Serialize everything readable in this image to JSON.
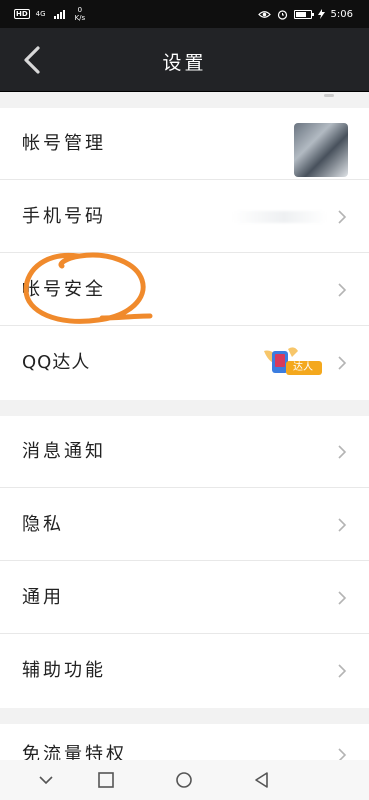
{
  "status_bar": {
    "network": "4G",
    "speed_value": "0",
    "speed_unit": "K/s",
    "time": "5:06"
  },
  "header": {
    "title": "设置",
    "back_icon": "chevron-left-icon"
  },
  "groups": [
    {
      "items": [
        {
          "label": "帐号管理",
          "accessory": "avatar"
        },
        {
          "label": "手机号码",
          "accessory": "phone-number"
        },
        {
          "label": "帐号安全",
          "accessory": "chevron-right-icon",
          "annotation": "orange circle highlight"
        },
        {
          "label": "QQ达人",
          "accessory": "qq-daren-badge",
          "badge_text": "达人"
        }
      ]
    },
    {
      "items": [
        {
          "label": "消息通知"
        },
        {
          "label": "隐私"
        },
        {
          "label": "通用"
        },
        {
          "label": "辅助功能"
        }
      ]
    },
    {
      "items": [
        {
          "label": "免流量特权"
        }
      ]
    }
  ],
  "colors": {
    "nav_bar": "#222326",
    "background": "#f2f2f2",
    "highlight": "#f08a2c",
    "badge": "#f4a81d"
  },
  "system_nav": [
    "chevron-down-icon",
    "square-icon",
    "circle-icon",
    "triangle-back-icon"
  ]
}
